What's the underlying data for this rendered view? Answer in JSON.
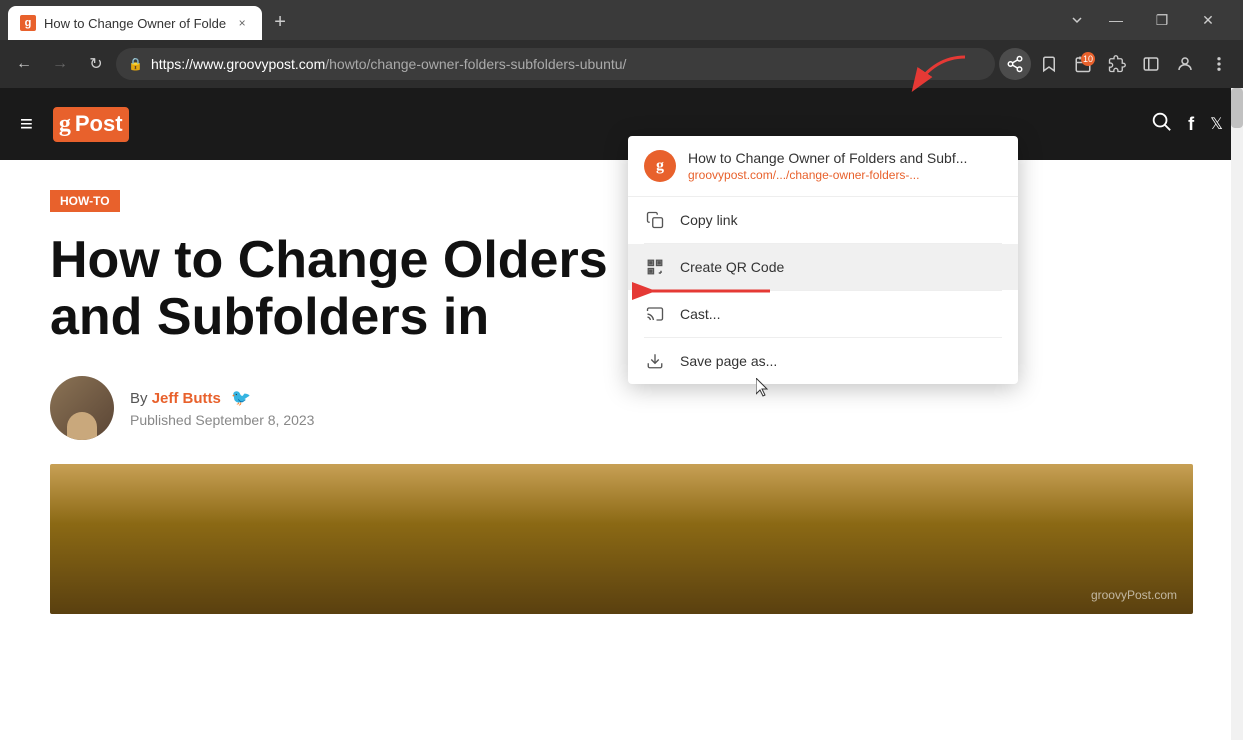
{
  "browser": {
    "tab": {
      "favicon_label": "g",
      "title": "How to Change Owner of Folde",
      "close_label": "×"
    },
    "new_tab_label": "+",
    "window_controls": {
      "minimize": "—",
      "maximize": "❐",
      "close": "✕"
    },
    "nav": {
      "back": "←",
      "forward": "→",
      "reload": "↻"
    },
    "address": {
      "lock": "🔒",
      "url_full": "https://www.groovypost.com/howto/change-owner-folders-subfolders-ubuntu/",
      "url_domain": "https://www.groovypost.com",
      "url_path": "/howto/change-owner-folders-subfolders-ubuntu/"
    },
    "toolbar": {
      "share_title": "Share",
      "bookmark_title": "Bookmark",
      "extensions_badge": "10",
      "extensions_title": "Extensions",
      "puzzle_title": "Extensions",
      "sidebar_title": "Sidebar",
      "profile_title": "Profile",
      "menu_title": "Menu"
    }
  },
  "dropdown": {
    "header": {
      "favicon_label": "g",
      "title": "How to Change Owner of Folders and Subf...",
      "url": "groovypost.com/.../change-owner-folders-..."
    },
    "items": [
      {
        "icon": "copy",
        "label": "Copy link"
      },
      {
        "icon": "qr",
        "label": "Create QR Code",
        "highlighted": true
      },
      {
        "icon": "cast",
        "label": "Cast..."
      },
      {
        "icon": "save",
        "label": "Save page as..."
      }
    ]
  },
  "site": {
    "logo_g": "g",
    "logo_post": "Post",
    "nav_hamburger": "≡"
  },
  "article": {
    "badge": "HOW-TO",
    "title_line1": "How to Change O",
    "title_line2": "and Subfolders in",
    "title_full": "How to Change Owner of Folders and Subfolders in Ubuntu",
    "author_by": "By ",
    "author_name": "Jeff Butts",
    "published_label": "Published",
    "published_date": "September 8, 2023",
    "watermark": "groovyPost.com"
  }
}
